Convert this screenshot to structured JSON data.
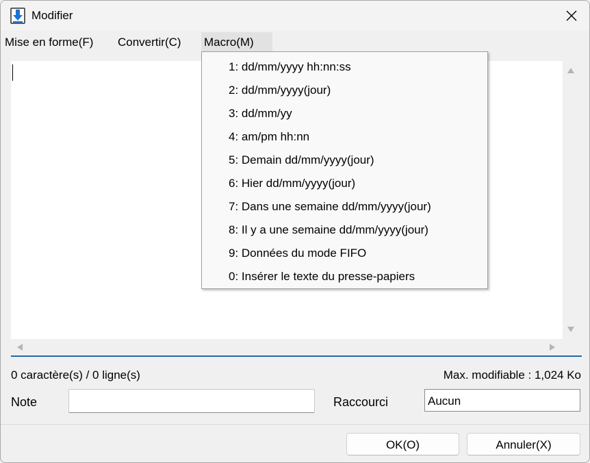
{
  "window": {
    "title": "Modifier"
  },
  "menubar": {
    "items": [
      {
        "label": "Mise en forme(F)"
      },
      {
        "label": "Convertir(C)"
      },
      {
        "label": "Macro(M)"
      }
    ]
  },
  "macro_menu": {
    "items": [
      "1: dd/mm/yyyy hh:nn:ss",
      "2: dd/mm/yyyy(jour)",
      "3: dd/mm/yy",
      "4: am/pm hh:nn",
      "5: Demain dd/mm/yyyy(jour)",
      "6: Hier dd/mm/yyyy(jour)",
      "7: Dans une semaine dd/mm/yyyy(jour)",
      "8: Il y a une semaine dd/mm/yyyy(jour)",
      "9: Données du mode FIFO",
      "0: Insérer le texte du presse-papiers"
    ]
  },
  "status": {
    "counts": "0 caractère(s) / 0 ligne(s)",
    "max": "Max. modifiable : 1,024 Ko"
  },
  "fields": {
    "note_label": "Note",
    "note_value": "",
    "shortcut_label": "Raccourci",
    "shortcut_value": "Aucun"
  },
  "buttons": {
    "ok": "OK(O)",
    "cancel": "Annuler(X)"
  },
  "colors": {
    "accent": "#1f6aa5",
    "app_icon": "#1a73d9"
  }
}
